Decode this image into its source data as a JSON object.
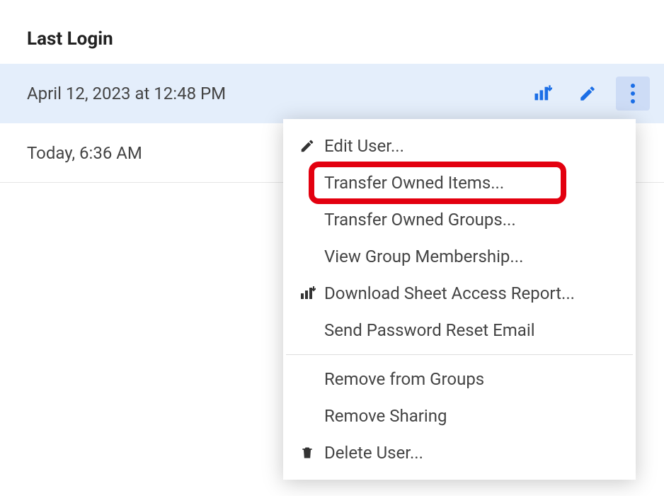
{
  "column_header": "Last Login",
  "rows": [
    {
      "value": "April 12, 2023 at 12:48 PM",
      "selected": true,
      "actions_visible": true
    },
    {
      "value": "Today, 6:36 AM",
      "selected": false,
      "actions_visible": false
    }
  ],
  "action_icons": {
    "download_report": "download-report-icon",
    "edit": "edit-icon",
    "more": "more-icon"
  },
  "menu": {
    "items": [
      {
        "label": "Edit User...",
        "icon": "pencil-icon",
        "highlighted": false
      },
      {
        "label": "Transfer Owned Items...",
        "icon": null,
        "highlighted": true
      },
      {
        "label": "Transfer Owned Groups...",
        "icon": null,
        "highlighted": false
      },
      {
        "label": "View Group Membership...",
        "icon": null,
        "highlighted": false
      },
      {
        "label": "Download Sheet Access Report...",
        "icon": "download-report-icon",
        "highlighted": false
      },
      {
        "label": "Send Password Reset Email",
        "icon": null,
        "highlighted": false
      },
      {
        "separator": true
      },
      {
        "label": "Remove from Groups",
        "icon": null,
        "highlighted": false
      },
      {
        "label": "Remove Sharing",
        "icon": null,
        "highlighted": false
      },
      {
        "label": "Delete User...",
        "icon": "trash-icon",
        "highlighted": false
      }
    ]
  },
  "colors": {
    "selected_row_bg": "#e4eefb",
    "icon_blue": "#1b6ee6",
    "highlight_red": "#e3000f"
  }
}
